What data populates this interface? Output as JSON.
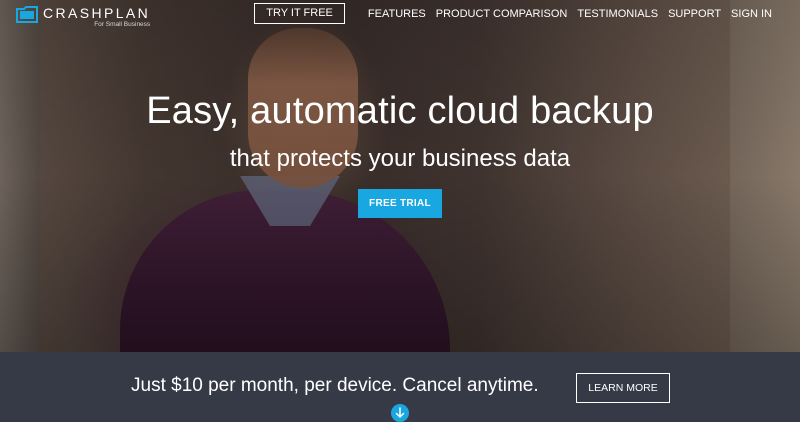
{
  "brand": {
    "name": "CRASHPLAN",
    "tagline": "For Small Business",
    "accent_color": "#18a7e0",
    "logo_icon": "crashplan-logo-icon"
  },
  "nav": {
    "cta": "TRY IT FREE",
    "links": [
      "FEATURES",
      "PRODUCT COMPARISON",
      "TESTIMONIALS",
      "SUPPORT",
      "SIGN IN"
    ]
  },
  "hero": {
    "headline": "Easy, automatic cloud backup",
    "subheadline": "that protects your business data",
    "cta": "FREE TRIAL"
  },
  "pricing_band": {
    "text": "Just $10 per month, per device. Cancel anytime.",
    "cta": "LEARN MORE",
    "background_color": "#363a47",
    "scroll_icon": "chevron-down-circle-icon"
  }
}
